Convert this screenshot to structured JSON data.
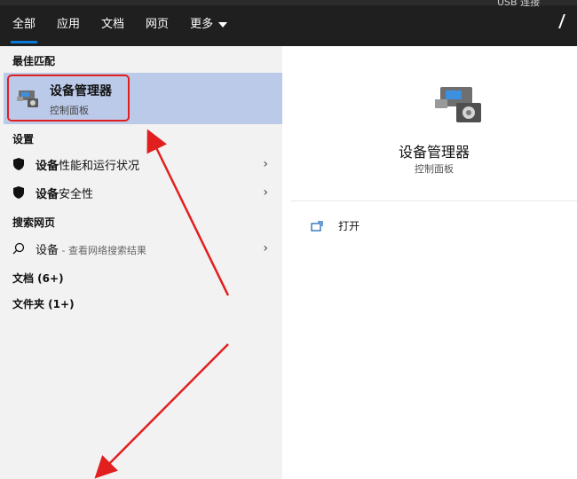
{
  "topbar": {
    "tabs": [
      {
        "label": "全部",
        "active": true
      },
      {
        "label": "应用",
        "active": false
      },
      {
        "label": "文档",
        "active": false
      },
      {
        "label": "网页",
        "active": false
      },
      {
        "label": "更多",
        "active": false
      }
    ],
    "peek_text": "USB 连接"
  },
  "left": {
    "best_match_title": "最佳匹配",
    "best_match": {
      "title": "设备管理器",
      "subtitle": "控制面板",
      "icon": "device-manager-icon"
    },
    "settings_title": "设置",
    "settings_items": [
      {
        "bold": "设备",
        "rest": "性能和运行状况",
        "icon": "shield-icon"
      },
      {
        "bold": "设备",
        "rest": "安全性",
        "icon": "shield-icon"
      }
    ],
    "web_title": "搜索网页",
    "web_item": {
      "bold": "设备",
      "suffix": " - 查看网络搜索结果",
      "icon": "search-icon"
    },
    "docs_label": "文档 (6+)",
    "folders_label": "文件夹 (1+)"
  },
  "right": {
    "title": "设备管理器",
    "subtitle": "控制面板",
    "open_label": "打开",
    "icon": "device-manager-icon"
  },
  "colors": {
    "topbar": "#1f1f1f",
    "accent": "#0a7ad8",
    "highlight": "#bccaea",
    "annotation": "#e11f1f"
  }
}
